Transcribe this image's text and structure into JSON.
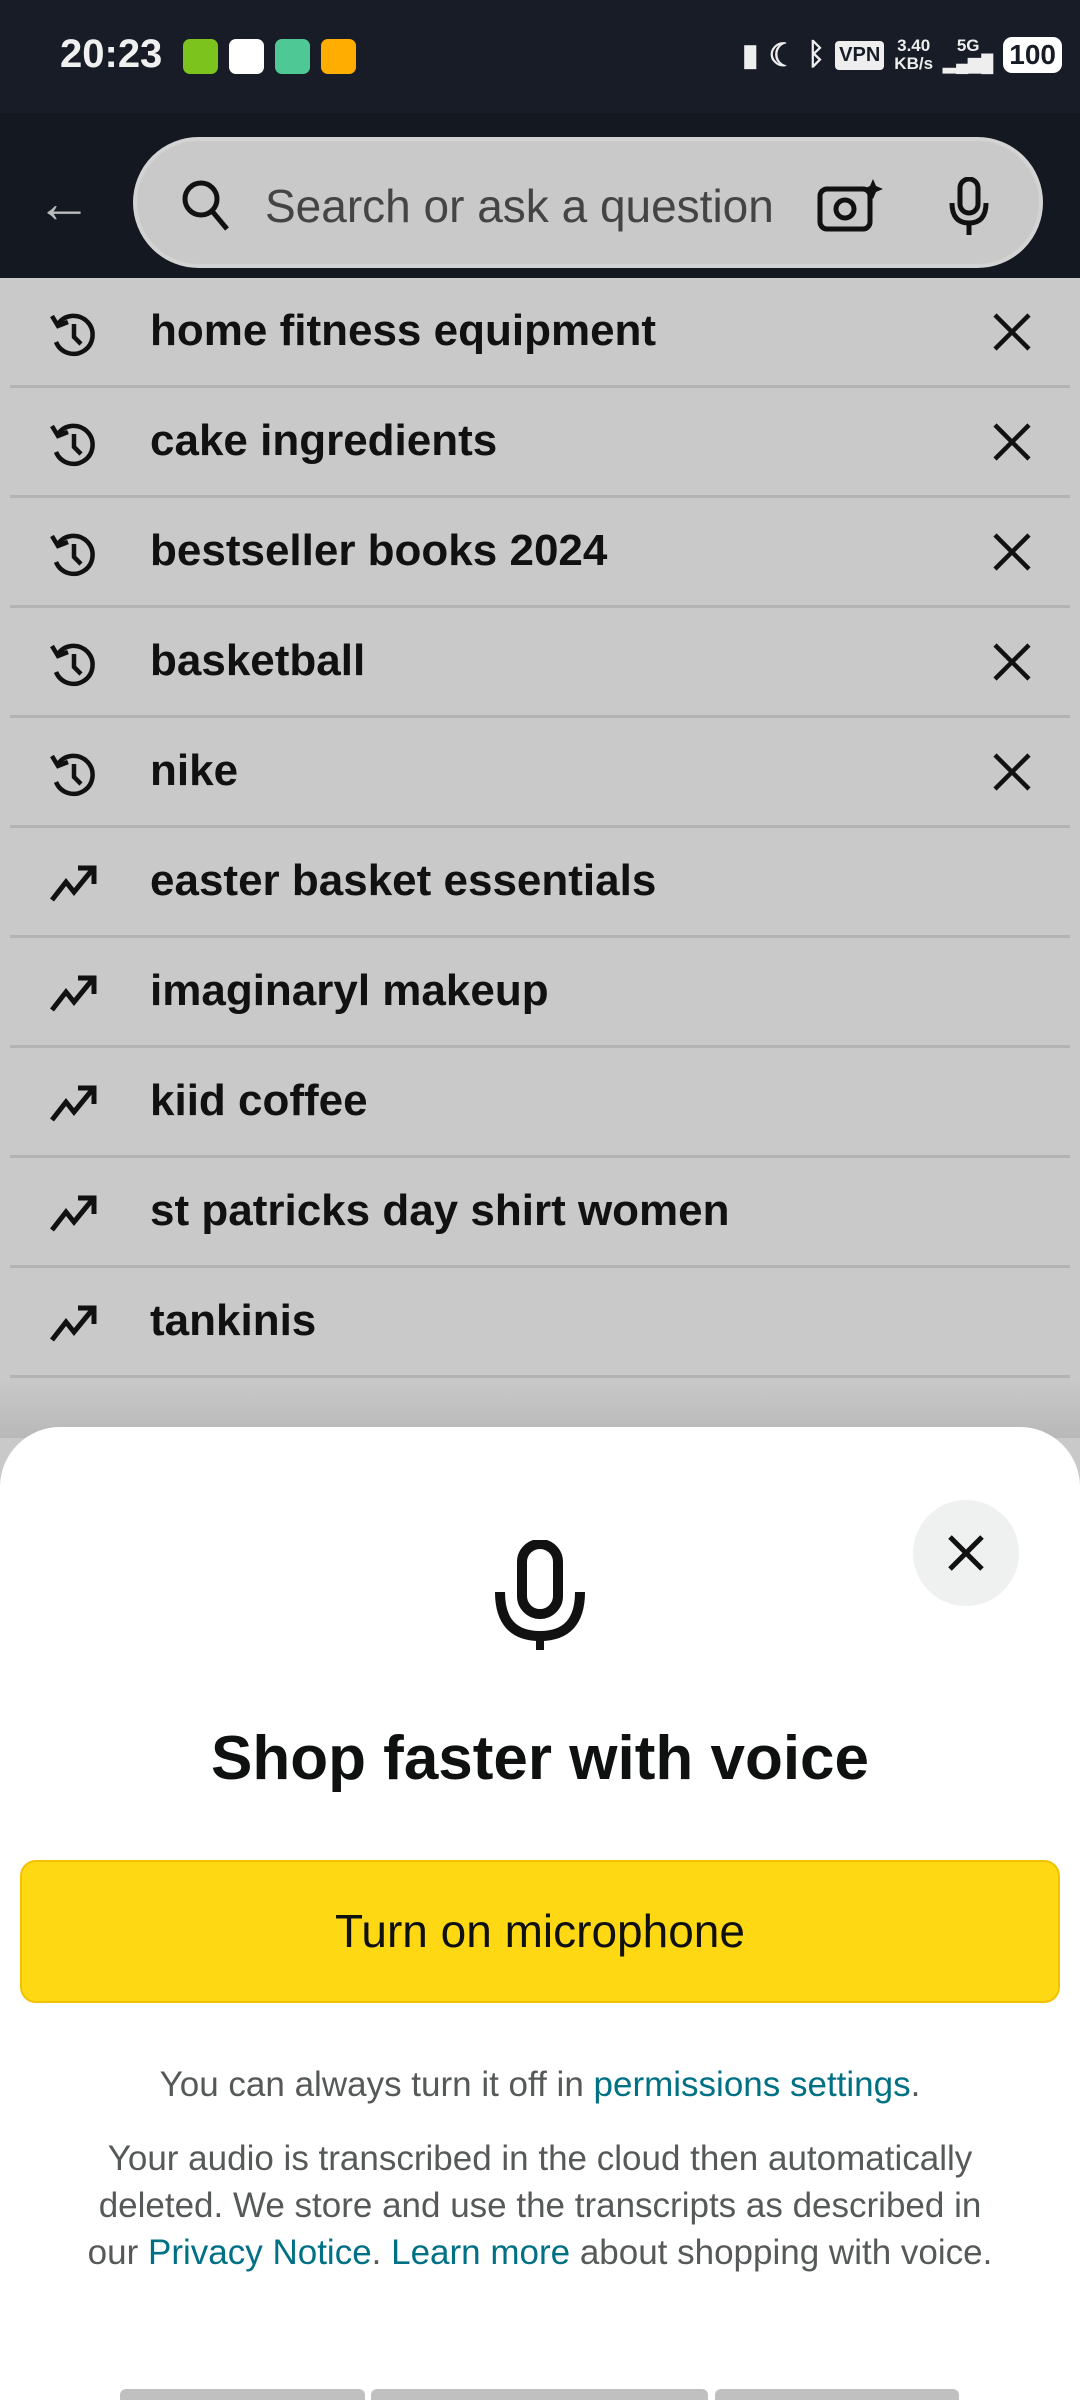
{
  "status_bar": {
    "time": "20:23",
    "vpn": "VPN",
    "speed_value": "3.40",
    "speed_unit": "KB/s",
    "network": "5G",
    "battery": "100"
  },
  "search": {
    "placeholder": "Search or ask a question"
  },
  "suggestions": [
    {
      "type": "history",
      "label": "home fitness equipment"
    },
    {
      "type": "history",
      "label": "cake ingredients"
    },
    {
      "type": "history",
      "label": "bestseller books 2024"
    },
    {
      "type": "history",
      "label": "basketball"
    },
    {
      "type": "history",
      "label": "nike"
    },
    {
      "type": "trending",
      "label": "easter basket essentials"
    },
    {
      "type": "trending",
      "label": "imaginaryl makeup"
    },
    {
      "type": "trending",
      "label": "kiid coffee"
    },
    {
      "type": "trending",
      "label": "st patricks day shirt women"
    },
    {
      "type": "trending",
      "label": "tankinis"
    }
  ],
  "voice_sheet": {
    "title": "Shop faster with voice",
    "button": "Turn on microphone",
    "p1_text": "You can always turn it off in ",
    "p1_link": "permissions settings",
    "p1_end": ".",
    "p2_text": "Your audio is transcribed in the cloud then automatically deleted. We store and use the transcripts as described in our ",
    "p2_link1": "Privacy Notice",
    "p2_mid": ". ",
    "p2_link2": "Learn more",
    "p2_end": " about shopping with voice."
  },
  "colors": {
    "accent": "#ffd814",
    "link": "#007185"
  }
}
